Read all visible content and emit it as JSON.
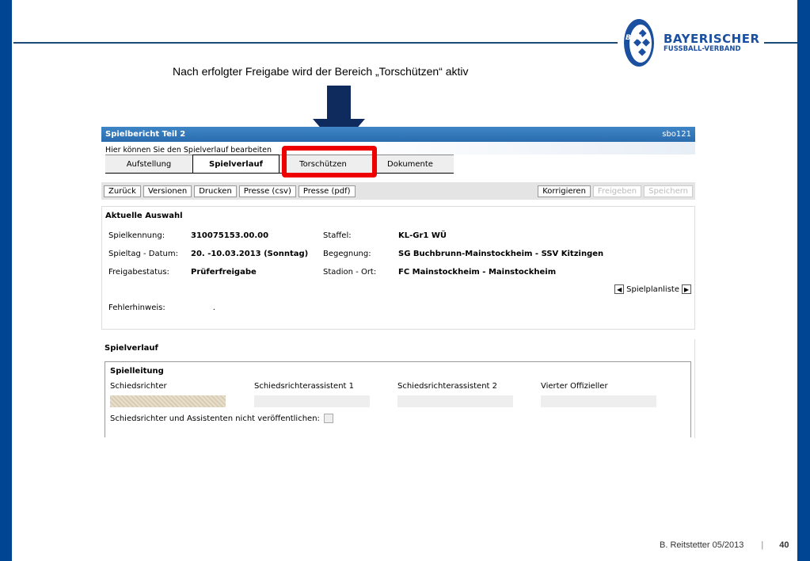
{
  "slide": {
    "caption": "Nach erfolgter Freigabe wird der Bereich „Torschützen“ aktiv",
    "author_date": "B. Reitstetter  05/2013",
    "separator": "|",
    "page": "40"
  },
  "logo": {
    "emblem": "BFV",
    "line1": "BAYERISCHER",
    "line2": "FUSSBALL-VERBAND"
  },
  "app": {
    "title": "Spielbericht Teil 2",
    "code": "sbo121",
    "subtitle": "Hier können Sie den Spielverlauf bearbeiten",
    "tabs": [
      {
        "label": "Aufstellung"
      },
      {
        "label": "Spielverlauf",
        "active": true
      },
      {
        "label": "Torschützen"
      },
      {
        "label": "Dokumente"
      }
    ],
    "toolbar_left": [
      "Zurück",
      "Versionen",
      "Drucken",
      "Presse (csv)",
      "Presse (pdf)"
    ],
    "toolbar_right": [
      {
        "label": "Korrigieren",
        "enabled": true
      },
      {
        "label": "Freigeben",
        "enabled": false
      },
      {
        "label": "Speichern",
        "enabled": false
      }
    ]
  },
  "auswahl": {
    "heading": "Aktuelle Auswahl",
    "fields": [
      {
        "label": "Spielkennung:",
        "value": "310075153.00.00",
        "label2": "Staffel:",
        "value2": "KL-Gr1 WÜ"
      },
      {
        "label": "Spieltag - Datum:",
        "value": "20. -10.03.2013 (Sonntag)",
        "label2": "Begegnung:",
        "value2": "SG Buchbrunn-Mainstockheim - SSV Kitzingen"
      },
      {
        "label": "Freigabestatus:",
        "value": "Prüferfreigabe",
        "label2": "Stadion - Ort:",
        "value2": "FC Mainstockheim - Mainstockheim"
      }
    ],
    "nav_label": "Spielplanliste",
    "fehler_label": "Fehlerhinweis:",
    "fehler_value": "."
  },
  "spielverlauf": {
    "heading": "Spielverlauf",
    "sub": "Spielleitung",
    "cols": [
      "Schiedsrichter",
      "Schiedsrichterassistent 1",
      "Schiedsrichterassistent 2",
      "Vierter Offizieller"
    ],
    "checkbox_label": "Schiedsrichter und Assistenten nicht veröffentlichen:"
  },
  "colors": {
    "brand": "#004494",
    "highlight": "#e00000",
    "arrow": "#0f2a5c"
  }
}
